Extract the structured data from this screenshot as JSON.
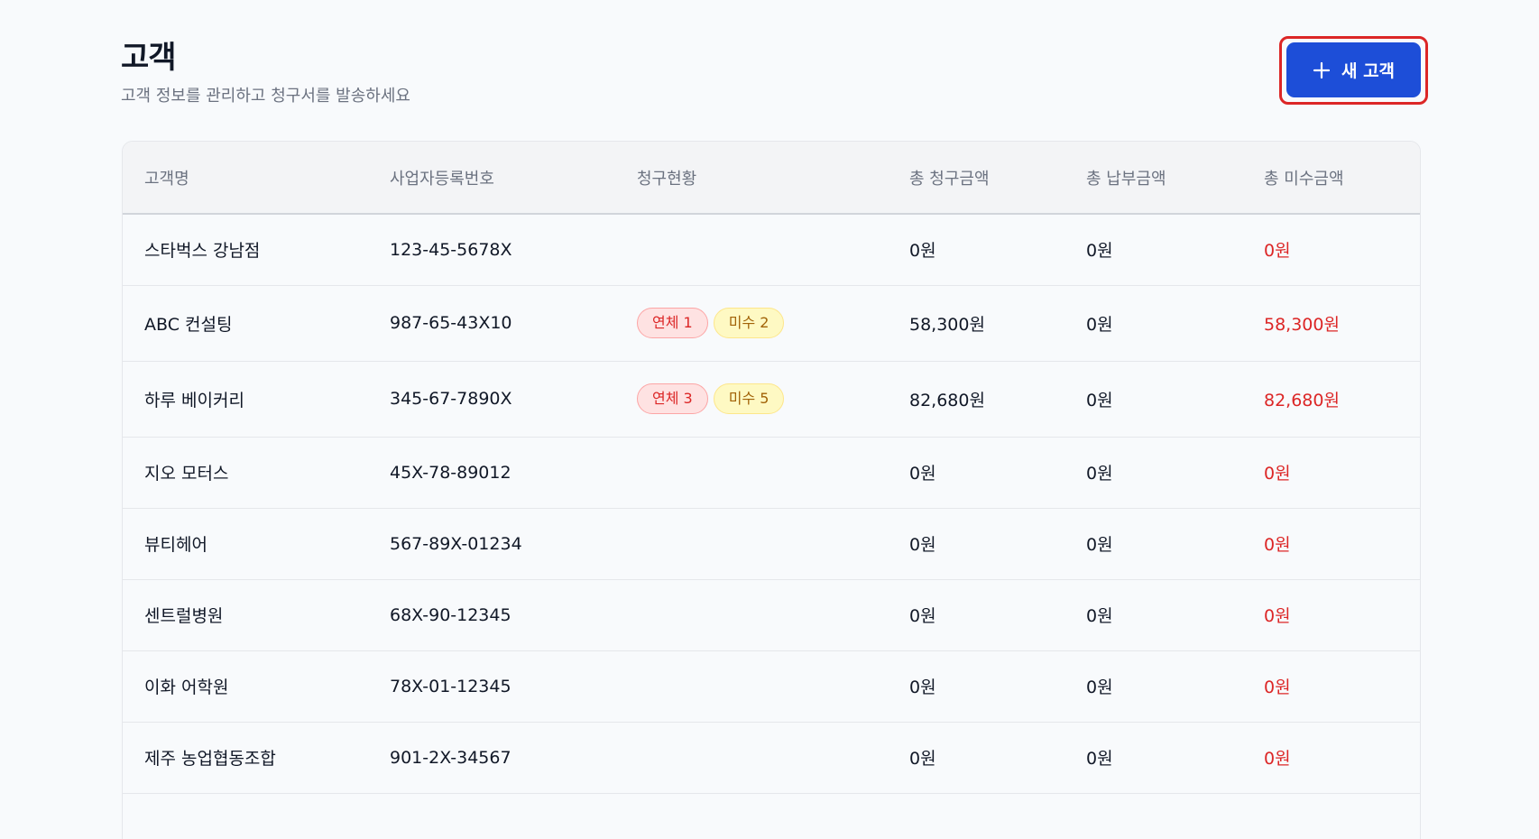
{
  "header": {
    "title": "고객",
    "subtitle": "고객 정보를 관리하고 청구서를 발송하세요",
    "new_button_label": "새 고객"
  },
  "table": {
    "columns": [
      "고객명",
      "사업자등록번호",
      "청구현황",
      "총 청구금액",
      "총 납부금액",
      "총 미수금액"
    ],
    "rows": [
      {
        "name": "스타벅스 강남점",
        "reg_no": "123-45-5678X",
        "badges": [],
        "billed": "0원",
        "paid": "0원",
        "due": "0원"
      },
      {
        "name": "ABC 컨설팅",
        "reg_no": "987-65-43X10",
        "badges": [
          {
            "label": "연체 1",
            "type": "overdue"
          },
          {
            "label": "미수 2",
            "type": "unpaid"
          }
        ],
        "billed": "58,300원",
        "paid": "0원",
        "due": "58,300원"
      },
      {
        "name": "하루 베이커리",
        "reg_no": "345-67-7890X",
        "badges": [
          {
            "label": "연체 3",
            "type": "overdue"
          },
          {
            "label": "미수 5",
            "type": "unpaid"
          }
        ],
        "billed": "82,680원",
        "paid": "0원",
        "due": "82,680원"
      },
      {
        "name": "지오 모터스",
        "reg_no": "45X-78-89012",
        "badges": [],
        "billed": "0원",
        "paid": "0원",
        "due": "0원"
      },
      {
        "name": "뷰티헤어",
        "reg_no": "567-89X-01234",
        "badges": [],
        "billed": "0원",
        "paid": "0원",
        "due": "0원"
      },
      {
        "name": "센트럴병원",
        "reg_no": "68X-90-12345",
        "badges": [],
        "billed": "0원",
        "paid": "0원",
        "due": "0원"
      },
      {
        "name": "이화 어학원",
        "reg_no": "78X-01-12345",
        "badges": [],
        "billed": "0원",
        "paid": "0원",
        "due": "0원"
      },
      {
        "name": "제주 농업협동조합",
        "reg_no": "901-2X-34567",
        "badges": [],
        "billed": "0원",
        "paid": "0원",
        "due": "0원"
      }
    ]
  },
  "icons": {
    "new_button": "plus-icon"
  },
  "colors": {
    "primary": "#1d4ed8",
    "focus_ring": "#dc2626",
    "due_text": "#dc2626",
    "overdue_bg": "#fee2e2",
    "unpaid_bg": "#fef9c3"
  }
}
